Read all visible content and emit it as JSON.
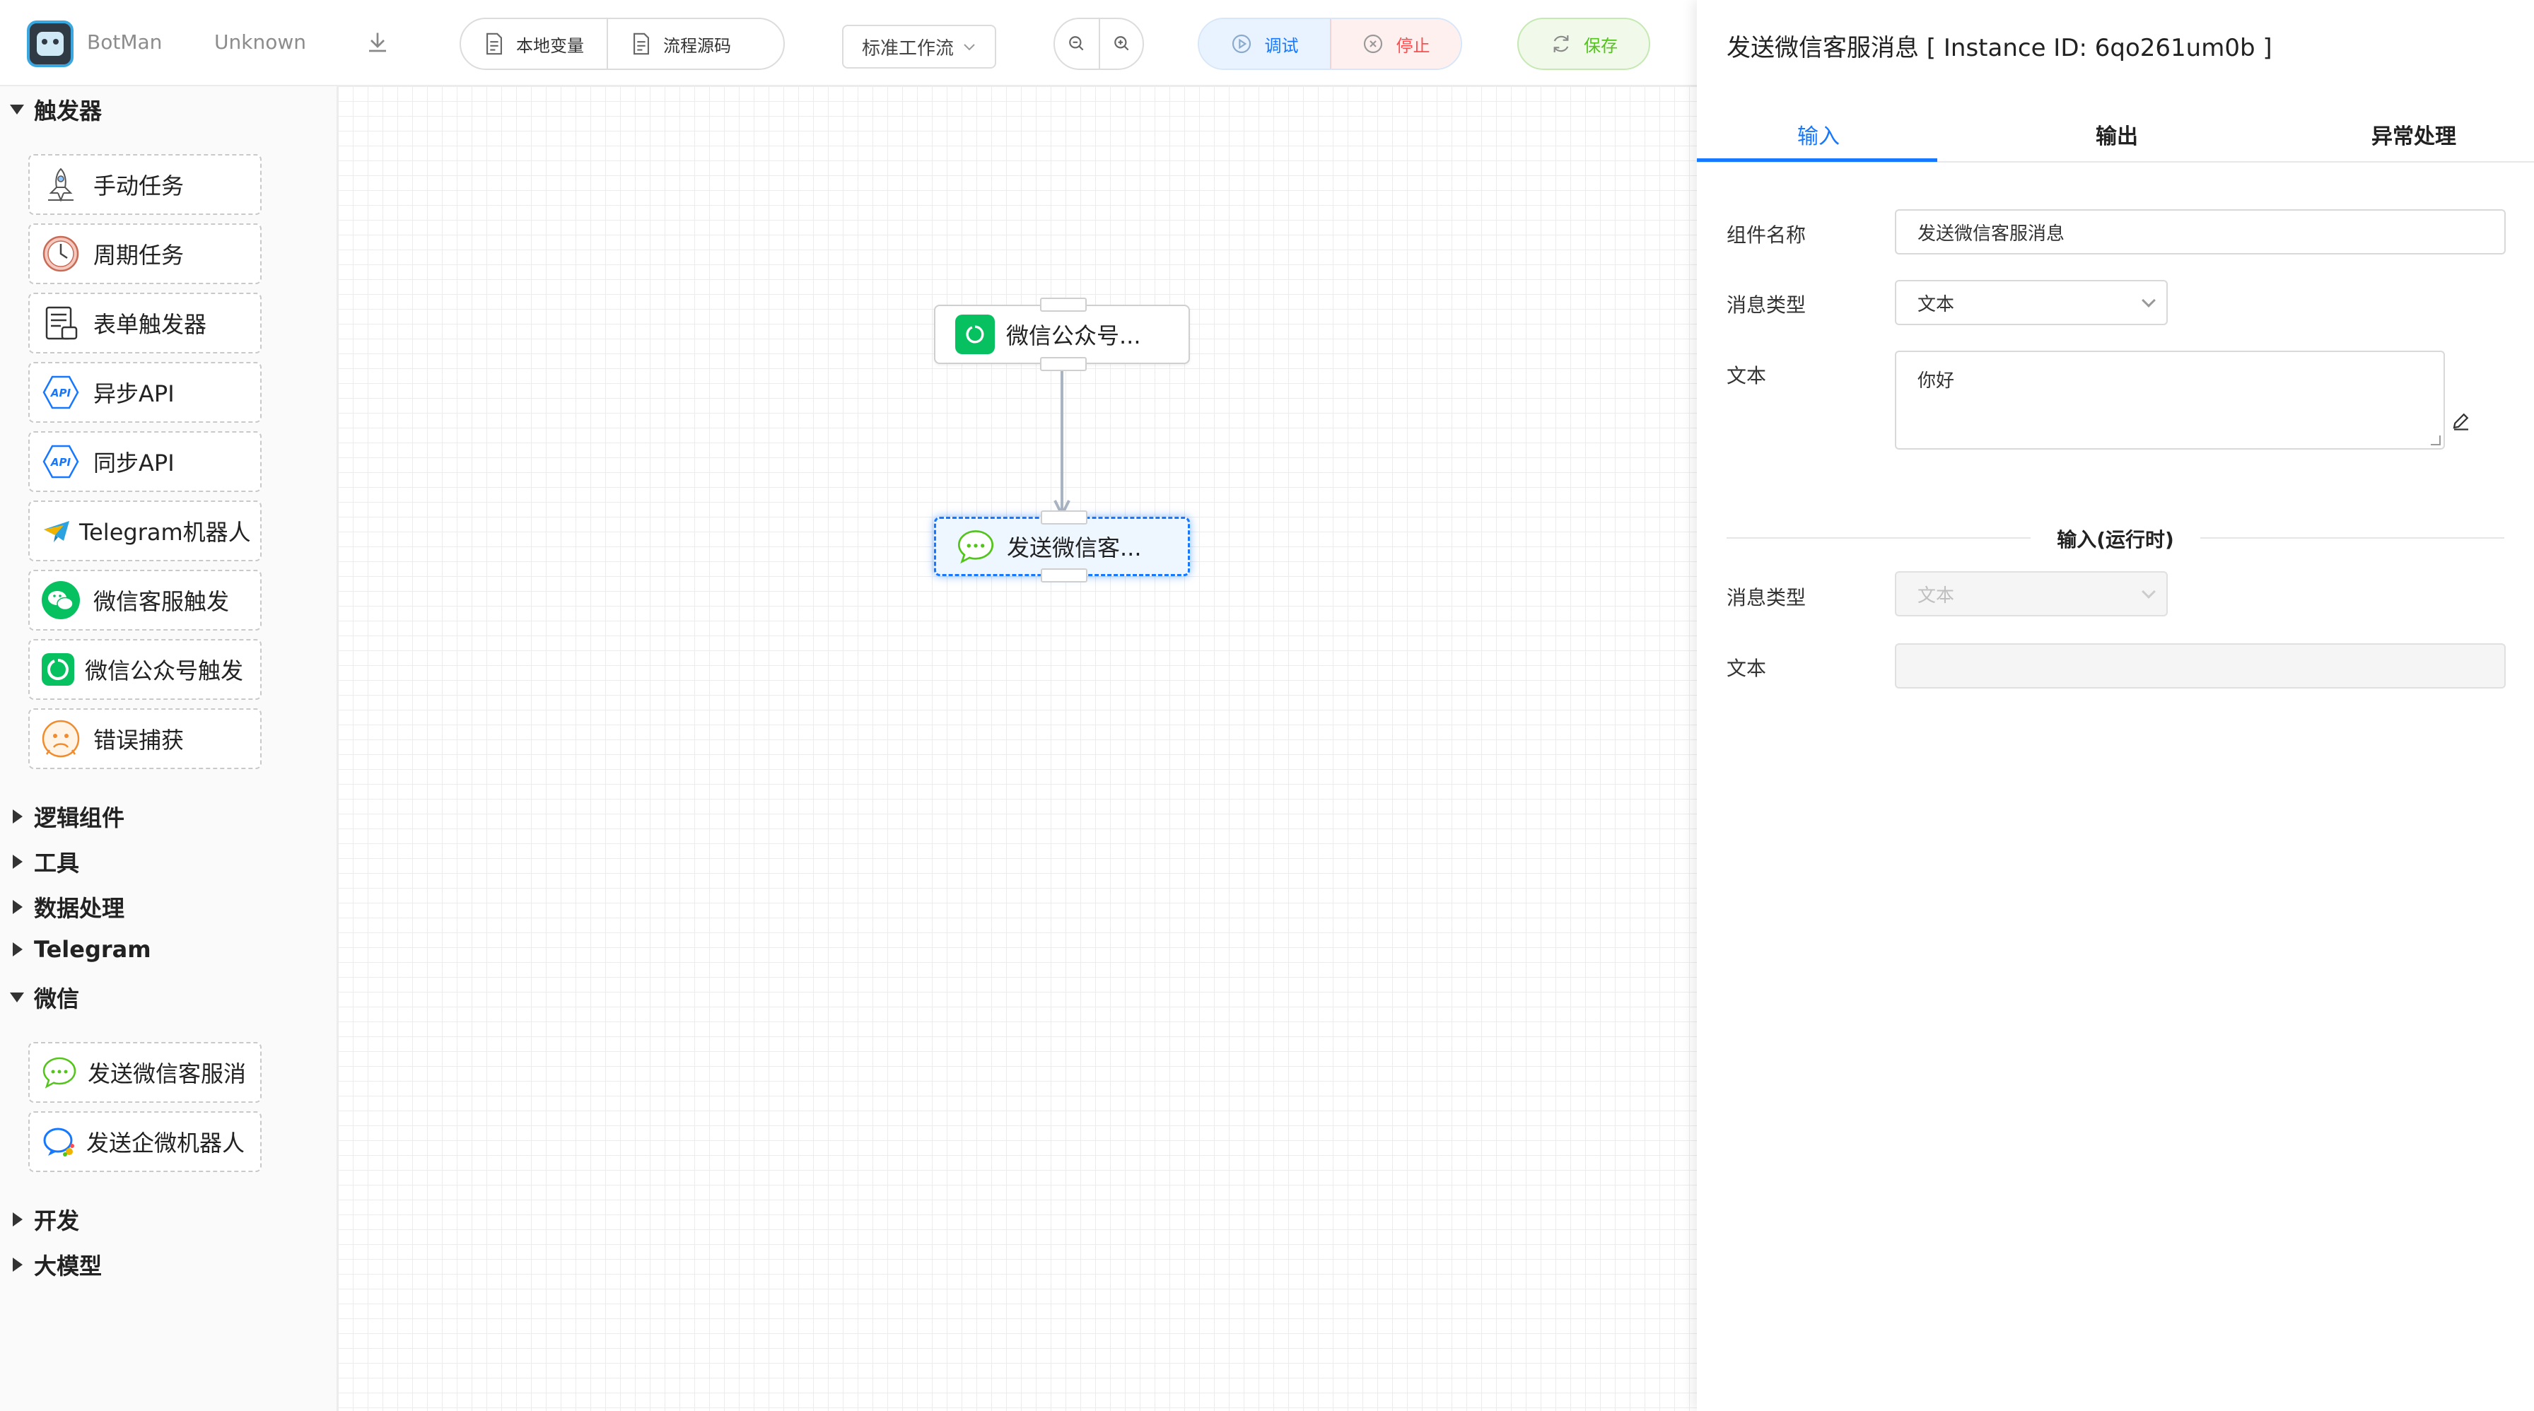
{
  "topbar": {
    "app_name": "BotMan",
    "user": "Unknown",
    "local_vars_label": "本地变量",
    "flow_source_label": "流程源码",
    "workflow_select": "标准工作流",
    "debug_label": "调试",
    "stop_label": "停止",
    "save_label": "保存"
  },
  "sidebar": {
    "triggers_title": "触发器",
    "triggers": [
      {
        "label": "手动任务",
        "icon": "rocket-icon"
      },
      {
        "label": "周期任务",
        "icon": "clock-icon"
      },
      {
        "label": "表单触发器",
        "icon": "form-icon"
      },
      {
        "label": "异步API",
        "icon": "api-icon"
      },
      {
        "label": "同步API",
        "icon": "api-icon"
      },
      {
        "label": "Telegram机器人",
        "icon": "telegram-icon"
      },
      {
        "label": "微信客服触发",
        "icon": "wechat-icon"
      },
      {
        "label": "微信公众号触发",
        "icon": "wechat-official-icon"
      },
      {
        "label": "错误捕获",
        "icon": "error-face-icon"
      }
    ],
    "collapsed_1": [
      "逻辑组件",
      "工具",
      "数据处理",
      "Telegram"
    ],
    "wechat_title": "微信",
    "wechat_items": [
      {
        "label": "发送微信客服消",
        "icon": "chat-bubble-icon"
      },
      {
        "label": "发送企微机器人",
        "icon": "wecom-icon"
      }
    ],
    "collapsed_2": [
      "开发",
      "大模型"
    ]
  },
  "canvas": {
    "node_1": "微信公众号...",
    "node_2": "发送微信客..."
  },
  "panel": {
    "title": "发送微信客服消息 [ Instance ID: 6qo261um0b ]",
    "tabs": [
      "输入",
      "输出",
      "异常处理"
    ],
    "component_name_label": "组件名称",
    "component_name_value": "发送微信客服消息",
    "msg_type_label": "消息类型",
    "msg_type_value": "文本",
    "text_label": "文本",
    "text_value": "你好",
    "runtime_title": "输入(运行时)",
    "runtime_msg_type_label": "消息类型",
    "runtime_msg_type_value": "文本",
    "runtime_text_label": "文本"
  },
  "colors": {
    "accent": "#1677ff",
    "danger": "#ff4d4f",
    "success": "#52c41a",
    "wechat_green": "#07c160"
  }
}
